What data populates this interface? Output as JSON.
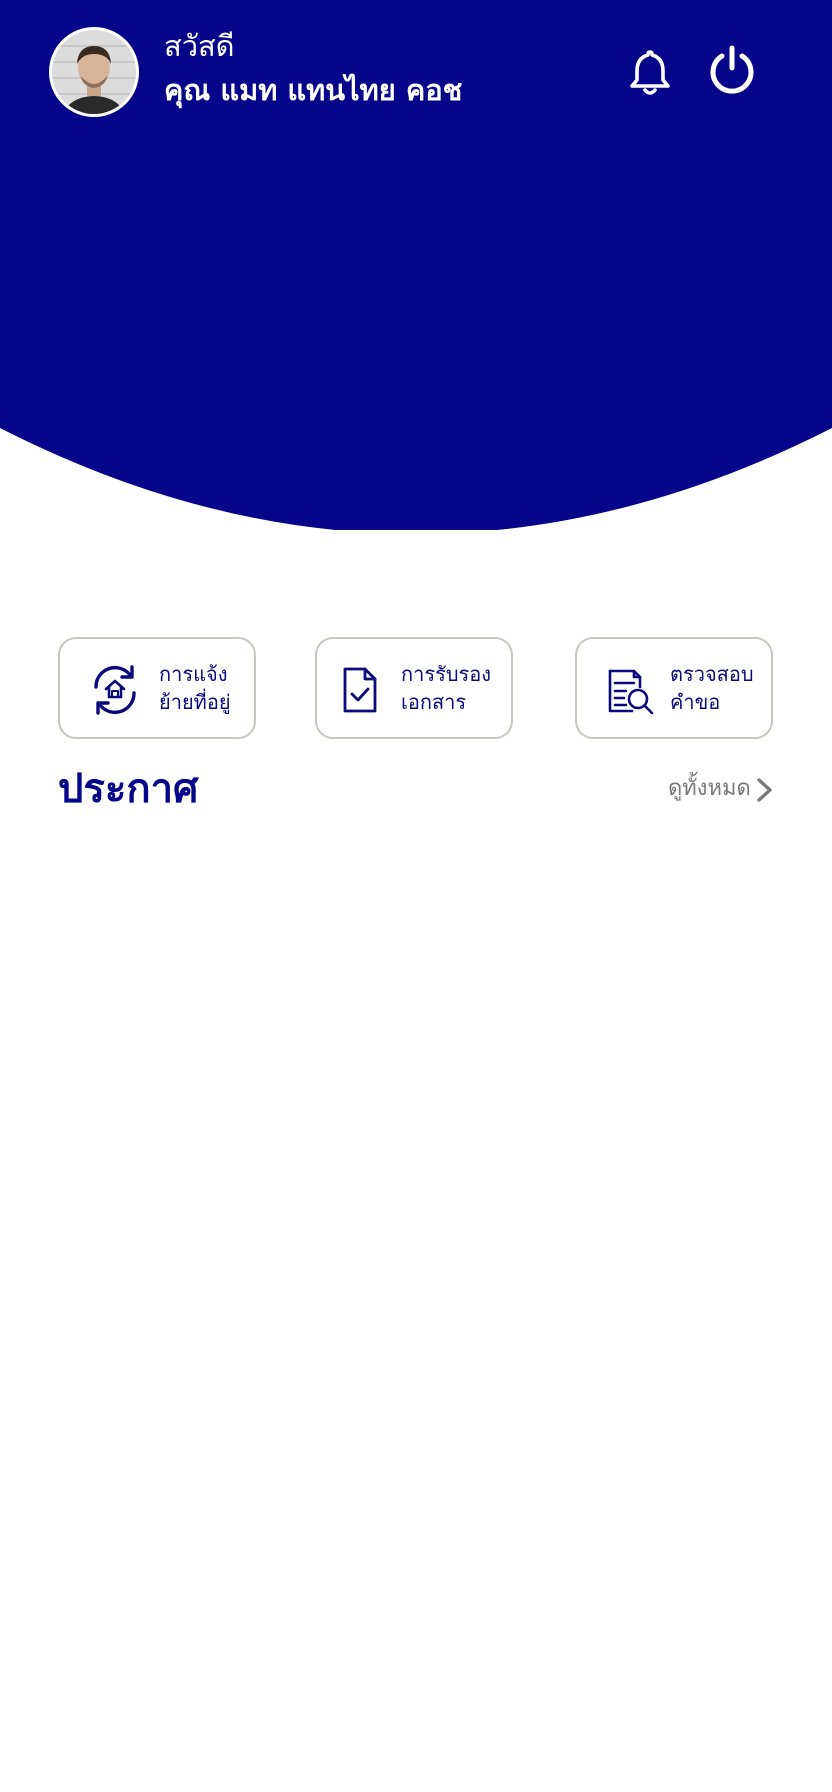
{
  "colors": {
    "brand": "#06068A",
    "header_bg": "#06068A",
    "accent_text": "#0A0A7A",
    "card_border": "#C9C6BD",
    "muted": "#7A7A7A"
  },
  "header": {
    "greeting": "สวัสดี",
    "user_name": "คุณ แมท แทนไทย คอช",
    "avatar_icon": "user-photo",
    "notification_icon": "bell-icon",
    "logout_icon": "power-icon"
  },
  "quick_actions": [
    {
      "icon": "home-sync-icon",
      "line1": "การแจ้ง",
      "line2": "ย้ายที่อยู่"
    },
    {
      "icon": "document-check-icon",
      "line1": "การรับรอง",
      "line2": "เอกสาร"
    },
    {
      "icon": "document-search-icon",
      "line1": "ตรวจสอบ",
      "line2": "คำขอ"
    }
  ],
  "announcements": {
    "title": "ประกาศ",
    "see_all_label": "ดูทั้งหมด"
  }
}
